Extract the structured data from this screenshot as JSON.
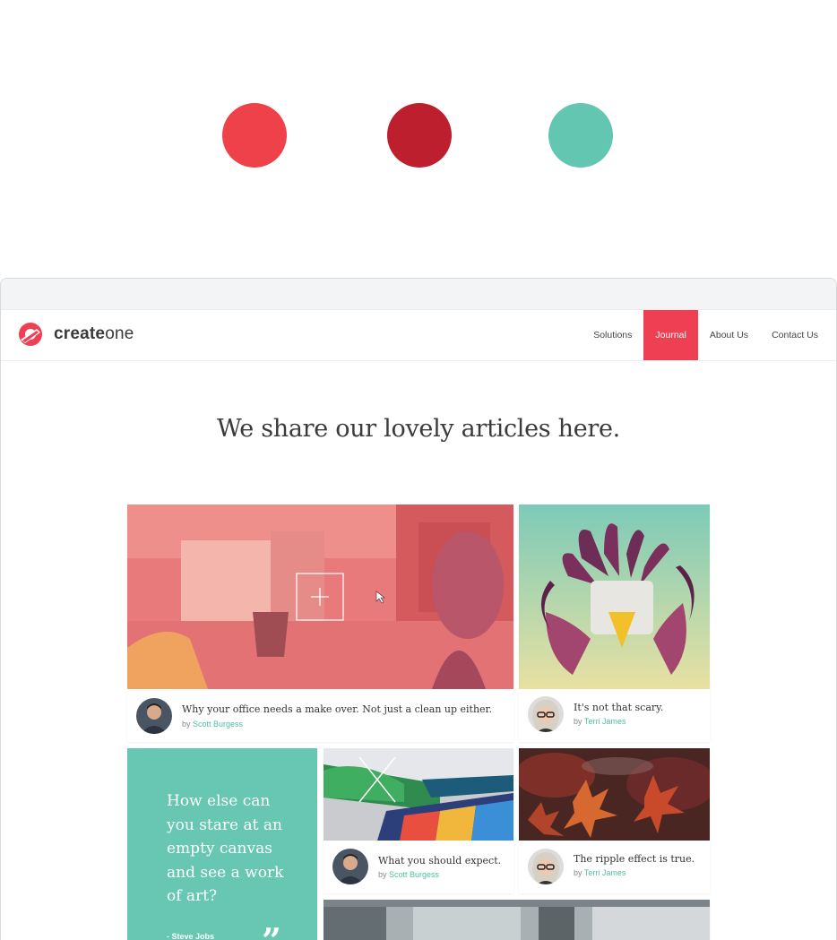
{
  "palette": {
    "primary": "#ef414a",
    "dark": "#bd1f2f",
    "accent": "#63c6b0"
  },
  "header": {
    "brand_prefix": "create",
    "brand_suffix": "one",
    "nav": [
      {
        "label": "Solutions"
      },
      {
        "label": "Journal",
        "active": true
      },
      {
        "label": "About Us"
      },
      {
        "label": "Contact Us"
      }
    ]
  },
  "main": {
    "headline": "We share our lovely articles here.",
    "articles": [
      {
        "title": "Why your office needs a make over. Not just a clean up either.",
        "by": "by",
        "author": "Scott Burgess"
      },
      {
        "title": "It's not that scary.",
        "by": "by",
        "author": "Terri James"
      },
      {
        "title": "What you should expect.",
        "by": "by",
        "author": "Scott Burgess"
      },
      {
        "title": "The ripple effect is true.",
        "by": "by",
        "author": "Terri James"
      }
    ],
    "quote": {
      "text": "How else can you stare at an empty canvas and see a work of art?",
      "author": "- Steve Jobs",
      "mark": "”"
    },
    "icons": [
      "plus-icon",
      "cursor-icon",
      "logo-icon"
    ]
  }
}
